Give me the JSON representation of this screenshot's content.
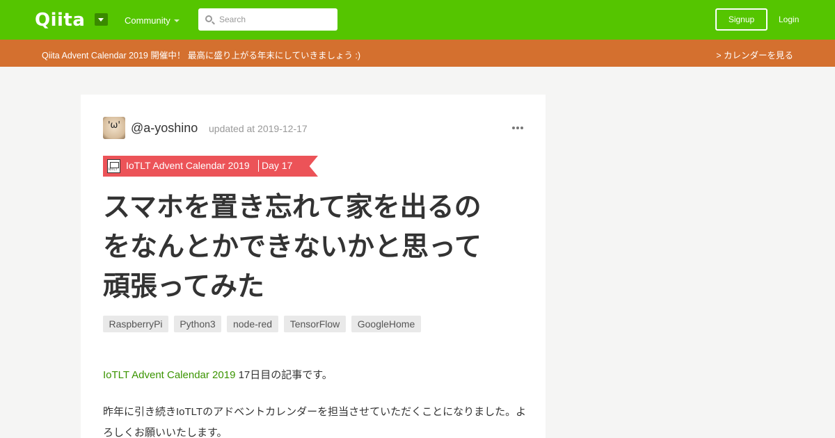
{
  "header": {
    "logo": "Qiita",
    "community_label": "Community",
    "search_placeholder": "Search",
    "signup_label": "Signup",
    "login_label": "Login"
  },
  "banner": {
    "text": "Qiita Advent Calendar 2019 開催中！ 最高に盛り上がる年末にしていきましょう :)",
    "link": "> カレンダーを見る"
  },
  "article": {
    "avatar_face": "'ω'",
    "author": "@a-yoshino",
    "updated": "updated at 2019-12-17",
    "calendar": {
      "name": "IoTLT Advent Calendar 2019",
      "day": "Day 17"
    },
    "title_lines": [
      "スマホを置き忘れて家を出るの",
      "をなんとかできないかと思って",
      "頑張ってみた"
    ],
    "tags": [
      "RaspberryPi",
      "Python3",
      "node-red",
      "TensorFlow",
      "GoogleHome"
    ],
    "body_link": "IoTLT Advent Calendar 2019",
    "body_line1_rest": " 17日目の記事です。",
    "body_para": "昨年に引き続きIoTLTのアドベントカレンダーを担当させていただくことになりました。よろしくお願いいたします。"
  },
  "colors": {
    "header_bg": "#55c500",
    "banner_bg": "#d4702f",
    "ribbon_bg": "#ec5358",
    "link": "#3a9400"
  }
}
